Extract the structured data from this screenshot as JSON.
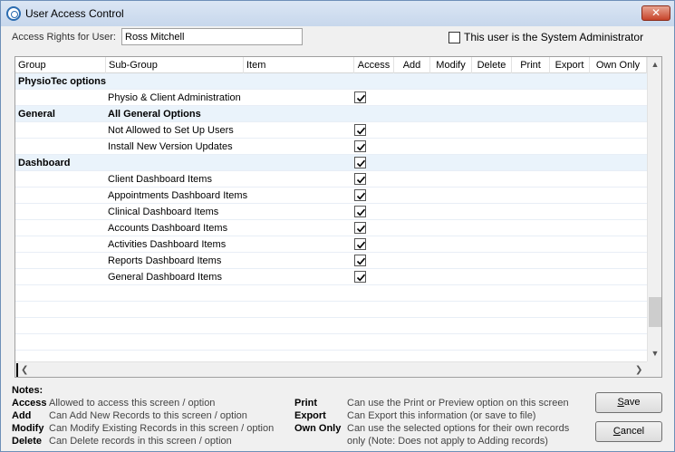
{
  "window": {
    "title": "User Access Control",
    "close_label": "✕"
  },
  "user": {
    "label": "Access Rights for User:",
    "value": "Ross Mitchell"
  },
  "admin": {
    "label": "This user is the System Administrator",
    "checked": false
  },
  "columns": [
    "Group",
    "Sub-Group",
    "Item",
    "Access",
    "Add",
    "Modify",
    "Delete",
    "Print",
    "Export",
    "Own Only"
  ],
  "rows": [
    {
      "group": "PhysioTec options",
      "subgroup": "",
      "item": "",
      "access": false,
      "bold": true,
      "alt": true
    },
    {
      "group": "",
      "subgroup": "Physio & Client Administration",
      "item": "",
      "access": true,
      "bold": false,
      "alt": false
    },
    {
      "group": "General",
      "subgroup": "All General Options",
      "item": "",
      "access": false,
      "bold": true,
      "alt": true
    },
    {
      "group": "",
      "subgroup": "Not Allowed to Set Up Users",
      "item": "",
      "access": true,
      "bold": false,
      "alt": false
    },
    {
      "group": "",
      "subgroup": "Install New Version Updates",
      "item": "",
      "access": true,
      "bold": false,
      "alt": false
    },
    {
      "group": "Dashboard",
      "subgroup": "",
      "item": "",
      "access": true,
      "bold": true,
      "alt": true
    },
    {
      "group": "",
      "subgroup": "Client Dashboard Items",
      "item": "",
      "access": true,
      "bold": false,
      "alt": false
    },
    {
      "group": "",
      "subgroup": "Appointments Dashboard Items",
      "item": "",
      "access": true,
      "bold": false,
      "alt": false
    },
    {
      "group": "",
      "subgroup": "Clinical Dashboard Items",
      "item": "",
      "access": true,
      "bold": false,
      "alt": false
    },
    {
      "group": "",
      "subgroup": "Accounts Dashboard Items",
      "item": "",
      "access": true,
      "bold": false,
      "alt": false
    },
    {
      "group": "",
      "subgroup": "Activities Dashboard Items",
      "item": "",
      "access": true,
      "bold": false,
      "alt": false
    },
    {
      "group": "",
      "subgroup": "Reports Dashboard Items",
      "item": "",
      "access": true,
      "bold": false,
      "alt": false
    },
    {
      "group": "",
      "subgroup": "General Dashboard Items",
      "item": "",
      "access": true,
      "bold": false,
      "alt": false
    }
  ],
  "notes": {
    "title": "Notes:",
    "left": [
      {
        "key": "Access",
        "text": "Allowed to access this screen / option"
      },
      {
        "key": "Add",
        "text": "Can Add New Records to this screen / option"
      },
      {
        "key": "Modify",
        "text": "Can Modify Existing Records in this screen / option"
      },
      {
        "key": "Delete",
        "text": "Can Delete records in this screen / option"
      }
    ],
    "right": [
      {
        "key": "Print",
        "text": "Can use the Print or Preview option on this screen"
      },
      {
        "key": "Export",
        "text": "Can Export this information (or save to file)"
      },
      {
        "key": "Own Only",
        "text": "Can use the selected options for their own records"
      },
      {
        "key": "",
        "text": "only (Note: Does not apply to Adding records)"
      }
    ]
  },
  "buttons": {
    "save": "Save",
    "cancel": "Cancel"
  },
  "colors": {
    "title_bar": "#c7d7ec",
    "alt_row": "#eaf3fb",
    "close": "#c7432a"
  }
}
